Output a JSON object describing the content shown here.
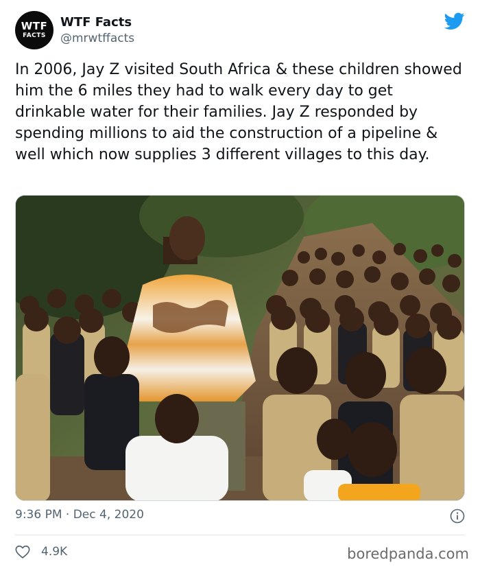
{
  "author": {
    "display_name": "WTF Facts",
    "handle": "@mrwtffacts",
    "avatar_line1": "WTF",
    "avatar_line2": "FACTS"
  },
  "tweet": {
    "text": "In 2006, Jay Z visited South Africa & these children showed him the 6 miles they had to walk every day to get drinkable water for their families. Jay Z responded by spending millions to aid the construction of a pipeline & well which now supplies 3 different villages to this day.",
    "time": "9:36 PM",
    "separator": "·",
    "date": "Dec 4, 2020",
    "likes": "4.9K"
  },
  "icons": {
    "brand": "twitter-bird-icon",
    "info": "info-icon",
    "like": "heart-icon"
  },
  "colors": {
    "twitter_blue": "#1d9bf0",
    "text_primary": "#0f1419",
    "text_secondary": "#536471"
  },
  "watermark": "boredpanda.com"
}
